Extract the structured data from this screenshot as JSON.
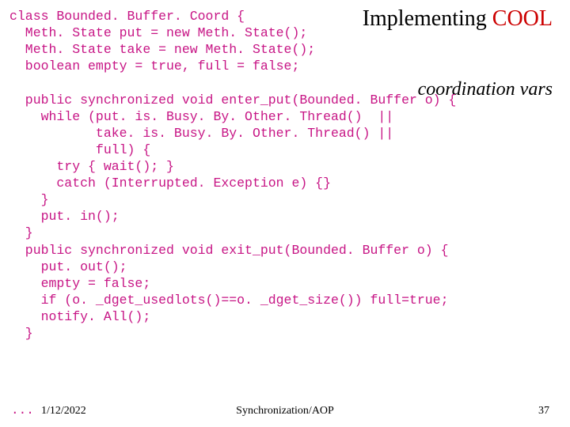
{
  "title": {
    "black": "Implementing ",
    "red": "COOL"
  },
  "annotation": "coordination vars",
  "code": "class Bounded. Buffer. Coord {\n  Meth. State put = new Meth. State();\n  Meth. State take = new Meth. State();\n  boolean empty = true, full = false;\n\n  public synchronized void enter_put(Bounded. Buffer o) {\n    while (put. is. Busy. By. Other. Thread()  ||\n           take. is. Busy. By. Other. Thread() ||\n           full) {\n      try { wait(); }\n      catch (Interrupted. Exception e) {}\n    }\n    put. in();\n  }\n  public synchronized void exit_put(Bounded. Buffer o) {\n    put. out();\n    empty = false;\n    if (o. _dget_usedlots()==o. _dget_size()) full=true;\n    notify. All();\n  }",
  "footer": {
    "dots": "...",
    "date": "1/12/2022",
    "center": "Synchronization/AOP",
    "page": "37"
  }
}
